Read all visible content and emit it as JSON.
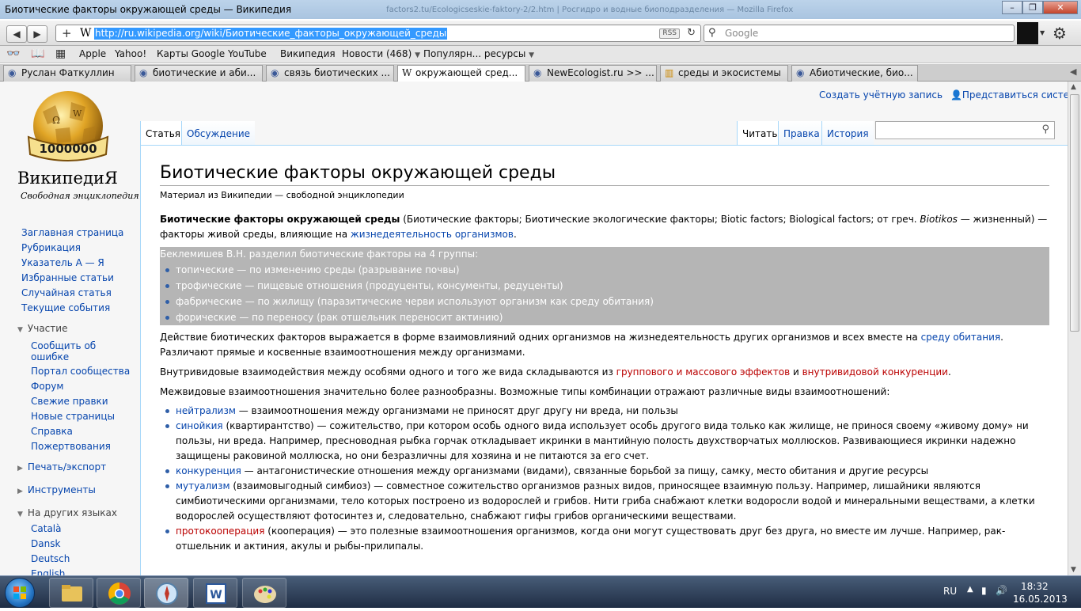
{
  "window": {
    "title": "Биотические факторы окружающей среды — Википедия",
    "title_faded": "factors2.tu/Ecologicseskie-faktory-2/2.htm | Росгидро и водные биоподразделения — Mozilla Firefox"
  },
  "navbar": {
    "url": "http://ru.wikipedia.org/wiki/Биотические_факторы_окружающей_среды",
    "rss": "RSS",
    "search_placeholder": "Google"
  },
  "bookmarks": [
    {
      "label": "Apple"
    },
    {
      "label": "Yahoo!"
    },
    {
      "label": "Карты Google"
    },
    {
      "label": "YouTube"
    },
    {
      "label": "Википедия"
    },
    {
      "label": "Новости (468)"
    },
    {
      "label": "Популярн... ресурсы"
    }
  ],
  "tabs": [
    {
      "label": "Руслан Фаткуллин"
    },
    {
      "label": "биотические и аби..."
    },
    {
      "label": "связь биотических ..."
    },
    {
      "label": "окружающей сред..."
    },
    {
      "label": "NewEcologist.ru >> ..."
    },
    {
      "label": "среды и экосистемы"
    },
    {
      "label": "Абиотические, био..."
    }
  ],
  "wiki": {
    "logo_text": "ВикипедиЯ",
    "logo_sub": "Свободная энциклопедия",
    "logo_number": "1000000",
    "nav": [
      "Заглавная страница",
      "Рубрикация",
      "Указатель А — Я",
      "Избранные статьи",
      "Случайная статья",
      "Текущие события"
    ],
    "participation_title": "Участие",
    "participation": [
      "Сообщить об ошибке",
      "Портал сообщества",
      "Форум",
      "Свежие правки",
      "Новые страницы",
      "Справка",
      "Пожертвования"
    ],
    "print_title": "Печать/экспорт",
    "tools_title": "Инструменты",
    "lang_title": "На других языках",
    "langs": [
      "Català",
      "Dansk",
      "Deutsch",
      "English"
    ],
    "create_account": "Создать учётную запись",
    "login": "Представиться системе",
    "tab_article": "Статья",
    "tab_talk": "Обсуждение",
    "tab_read": "Читать",
    "tab_edit": "Правка",
    "tab_history": "История"
  },
  "article": {
    "title": "Биотические факторы окружающей среды",
    "from": "Материал из Википедии — свободной энциклопедии",
    "intro_bold": "Биотические факторы окружающей среды",
    "intro_rest": " (Биотические факторы; Биотические экологические факторы; Biotic factors; Biological factors; от греч. ",
    "intro_italic": "Biotikos",
    "intro_rest2": " — жизненный) — факторы живой среды, влияющие на ",
    "intro_link": "жизнедеятельность организмов",
    "intro_end": ".",
    "highlight_lead": "Беклемишев В.Н. разделил биотические факторы на 4 группы:",
    "groups": [
      "топические — по изменению среды (разрывание почвы)",
      "трофические — пищевые отношения (продуценты, консументы, редуценты)",
      "фабрические — по жилищу (паразитические черви используют организм как среду обитания)",
      "форические — по переносу (рак отшельник переносит актинию)"
    ],
    "p2_a": "Действие биотических факторов выражается в форме взаимовлияний одних организмов на жизнедеятельность других организмов и всех вместе на ",
    "p2_link": "среду обитания",
    "p2_b": ". Различают прямые и косвенные взаимоотношения между организмами.",
    "p3_a": "Внутривидовые взаимодействия между особями одного и того же вида складываются из ",
    "p3_link1": "группового и массового эффектов",
    "p3_and": " и ",
    "p3_link2": "внутривидовой конкуренции",
    "p3_end": ".",
    "p4": "Межвидовые взаимоотношения значительно более разнообразны. Возможные типы комбинации отражают различные виды взаимоотношений:",
    "items": [
      {
        "term": "нейтрализм",
        "red": false,
        "text": " — взаимоотношения между организмами не приносят друг другу ни вреда, ни пользы"
      },
      {
        "term": "синойкия",
        "red": false,
        "text": " (квартирантство) — сожительство, при котором особь одного вида использует особь другого вида только как жилище, не принося своему «живому дому» ни пользы, ни вреда. Например, пресноводная рыбка горчак откладывает икринки в мантийную полость двухстворчатых моллюсков. Развивающиеся икринки надежно защищены раковиной моллюска, но они безразличны для хозяина и не питаются за его счет."
      },
      {
        "term": "конкуренция",
        "red": false,
        "text": " — антагонистические отношения между организмами (видами), связанные борьбой за пищу, самку, место обитания и другие ресурсы"
      },
      {
        "term": "мутуализм",
        "red": false,
        "text": " (взаимовыгодный симбиоз) — совместное сожительство организмов разных видов, приносящее взаимную пользу. Например, лишайники являются симбиотическими организмами, тело которых построено из водорослей и грибов. Нити гриба снабжают клетки водоросли водой и минеральными веществами, а клетки водорослей осуществляют фотосинтез и, следовательно, снабжают гифы грибов органическими веществами."
      },
      {
        "term": "протокооперация",
        "red": true,
        "text": " (кооперация) — это полезные взаимоотношения организмов, когда они могут существовать друг без друга, но вместе им лучше. Например, рак-отшельник и актиния, акулы и рыбы-прилипалы."
      }
    ]
  },
  "taskbar": {
    "lang": "RU",
    "time": "18:32",
    "date": "16.05.2013"
  },
  "colors": {
    "link": "#0645ad",
    "redlink": "#ba0000",
    "highlight": "#b5b5b5"
  }
}
